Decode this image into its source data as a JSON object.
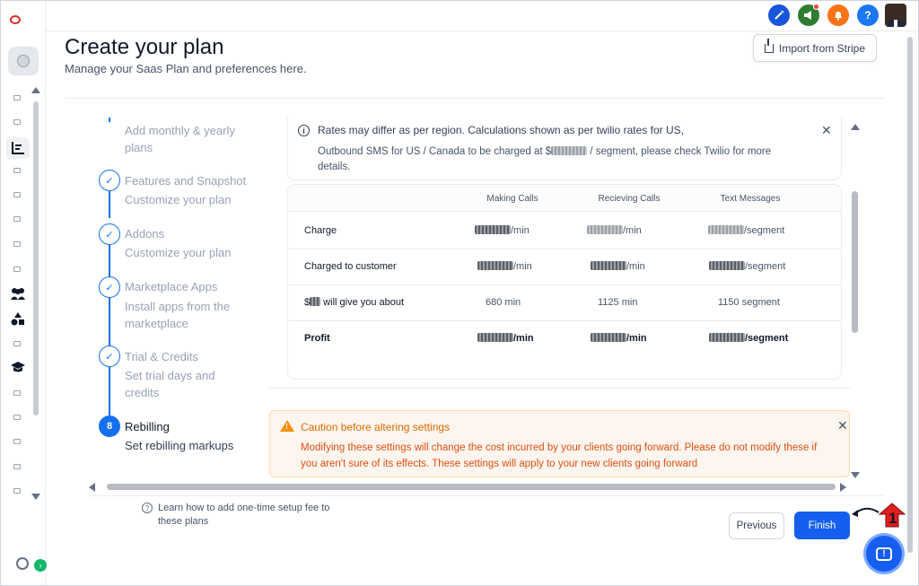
{
  "header": {
    "title": "Create your plan",
    "subtitle": "Manage your Saas Plan and preferences here.",
    "import_label": "Import from Stripe"
  },
  "topbar": {
    "icons": [
      "magic-wand-icon",
      "megaphone-icon",
      "bell-icon",
      "help-icon",
      "avatar"
    ],
    "help_glyph": "?",
    "colors": {
      "wand": "#1a56db",
      "megaphone": "#2e7d32",
      "bell": "#f97316",
      "help": "#1d76f2"
    }
  },
  "stepper": {
    "steps": [
      {
        "title": "",
        "desc": "Add monthly & yearly plans",
        "state": "complete"
      },
      {
        "title": "Features and Snapshot",
        "desc": "Customize your plan",
        "state": "complete"
      },
      {
        "title": "Addons",
        "desc": "Customize your plan",
        "state": "complete"
      },
      {
        "title": "Marketplace Apps",
        "desc": "Install apps from the marketplace",
        "state": "complete"
      },
      {
        "title": "Trial & Credits",
        "desc": "Set trial days and credits",
        "state": "complete"
      },
      {
        "title": "Rebilling",
        "desc": "Set rebilling markups",
        "state": "active",
        "number": "8"
      }
    ]
  },
  "info": {
    "line1": "Rates may differ as per region. Calculations shown as per twilio rates for US,",
    "line2_prefix": "Outbound SMS for US / Canada to be charged at $",
    "line2_suffix": " / segment, please check Twilio for more details."
  },
  "rates": {
    "columns": [
      "Making Calls",
      "Recieving Calls",
      "Text Messages"
    ],
    "rows": [
      {
        "label": "Charge",
        "cells": [
          "/min",
          "/min",
          "/segment"
        ],
        "strong": false
      },
      {
        "label": "Charged to customer",
        "cells": [
          "/min",
          "/min",
          "/segment"
        ],
        "strong": false
      },
      {
        "label_prefix": "$",
        "label": " will give you about",
        "cells": [
          "680 min",
          "1125 min",
          "1150 segment"
        ],
        "strong": false,
        "plain": true
      },
      {
        "label": "Profit",
        "cells": [
          "/min",
          "/min",
          "/segment"
        ],
        "strong": true
      }
    ]
  },
  "caution": {
    "title": "Caution before altering settings",
    "text": "Modifying these settings will change the cost incurred by your clients going forward. Please do not modify these if you aren't sure of its effects. These settings will apply to your new clients going forward"
  },
  "footer": {
    "help_text": "Learn how to add one-time setup fee to these plans",
    "previous_label": "Previous",
    "finish_label": "Finish",
    "annotation_number": "1"
  },
  "colors": {
    "primary": "#155eef",
    "caution_bg": "#fef6ee",
    "caution_text": "#e04f16"
  }
}
